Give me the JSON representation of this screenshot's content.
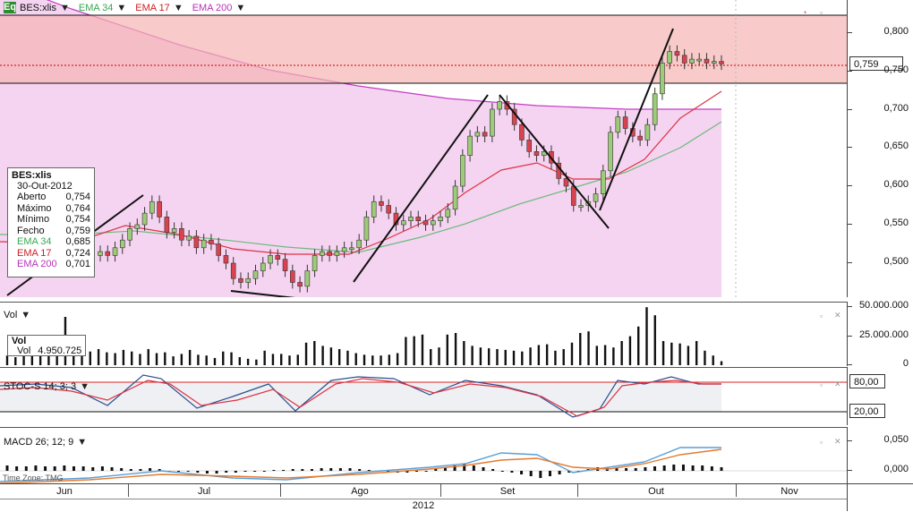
{
  "price_pane": {
    "symbol": "BES:xlis",
    "symbol_icon": "Eq",
    "indicators": [
      {
        "label": "EMA 34",
        "color": "#39a852"
      },
      {
        "label": "EMA 17",
        "color": "#cc2222"
      },
      {
        "label": "EMA 200",
        "color": "#b833b8"
      }
    ],
    "last_price": "0,759",
    "y_ticks": [
      "0,800",
      "0,750",
      "0,700",
      "0,650",
      "0,600",
      "0,550",
      "0,500"
    ]
  },
  "info_box": {
    "title": "BES:xlis",
    "date": "30-Out-2012",
    "rows": [
      {
        "label": "Aberto",
        "value": "0,754",
        "color": "#111"
      },
      {
        "label": "Máximo",
        "value": "0,764",
        "color": "#111"
      },
      {
        "label": "Mínimo",
        "value": "0,754",
        "color": "#111"
      },
      {
        "label": "Fecho",
        "value": "0,759",
        "color": "#111"
      },
      {
        "label": "EMA 34",
        "value": "0,685",
        "color": "#39a852"
      },
      {
        "label": "EMA 17",
        "value": "0,724",
        "color": "#cc2222"
      },
      {
        "label": "EMA 200",
        "value": "0,701",
        "color": "#b833b8"
      }
    ]
  },
  "volume_pane": {
    "label": "Vol",
    "box_title": "Vol",
    "box_label": "Vol",
    "box_value": "4.950.725",
    "y_ticks": [
      "50.000.000",
      "25.000.000",
      "0"
    ]
  },
  "stoch_pane": {
    "label": "STOC-S 14; 3; 3",
    "y_ticks": [
      "80,00",
      "20,00"
    ]
  },
  "macd_pane": {
    "label": "MACD 26; 12; 9",
    "y_ticks": [
      "0,050",
      "0,000"
    ]
  },
  "time_zone": "Time Zone: TMG",
  "x_axis": {
    "months": [
      "Jun",
      "Jul",
      "Ago",
      "Set",
      "Out",
      "Nov"
    ],
    "year": "2012"
  },
  "colors": {
    "up_candle": "#8fc26a",
    "down_candle": "#d8434f",
    "resistance_band": "#f7c3c3",
    "ema200_fill": "#f1c9ea"
  }
}
